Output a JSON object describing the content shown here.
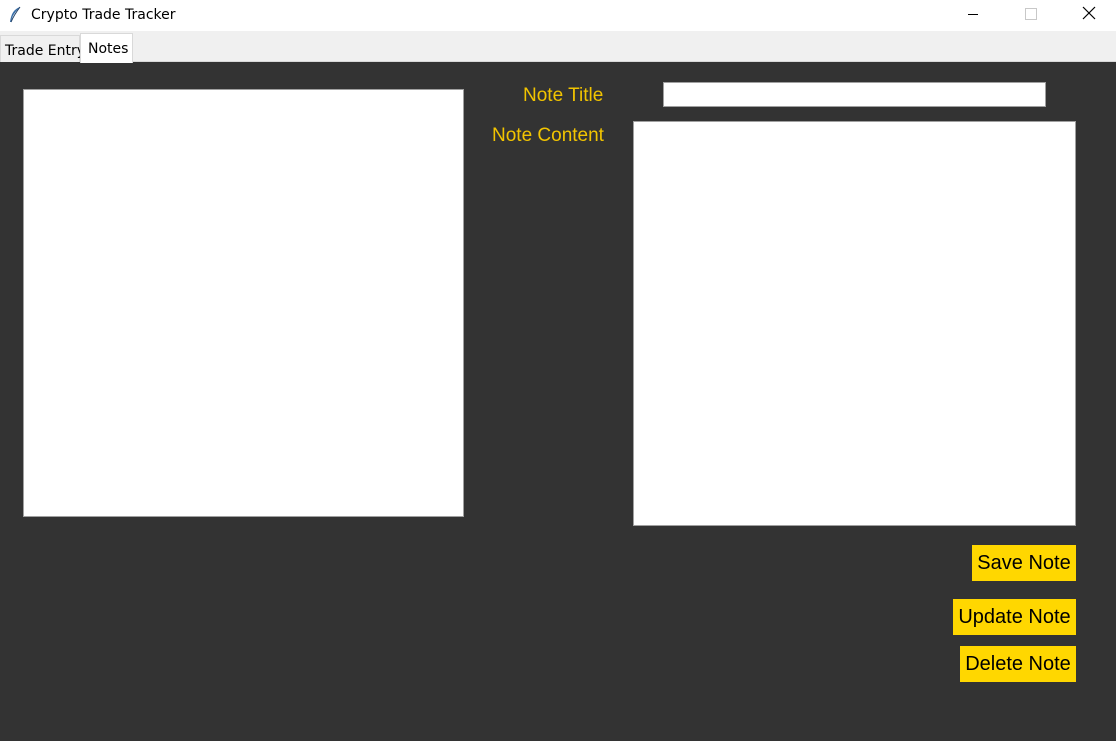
{
  "window": {
    "title": "Crypto Trade Tracker",
    "icon": "feather-icon",
    "controls": [
      "minimize-icon",
      "maximize-icon",
      "close-icon"
    ]
  },
  "tabs": [
    {
      "label": "Trade Entry",
      "selected": false
    },
    {
      "label": "Notes",
      "selected": true
    }
  ],
  "notes": {
    "list_items": [],
    "title_label": "Note Title",
    "title_value": "",
    "content_label": "Note Content",
    "content_value": "",
    "buttons": {
      "save": "Save Note",
      "update": "Update Note",
      "delete": "Delete Note"
    }
  },
  "colors": {
    "background": "#333333",
    "label": "#f2c400",
    "button": "#ffd700"
  }
}
